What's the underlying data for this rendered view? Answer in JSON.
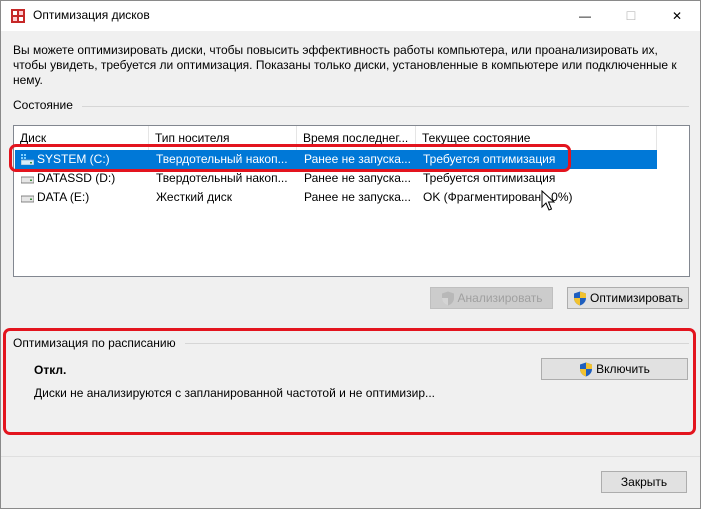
{
  "window": {
    "title": "Оптимизация дисков",
    "minimize_glyph": "—",
    "maximize_glyph": "☐",
    "close_glyph": "✕"
  },
  "description": "Вы можете оптимизировать диски, чтобы повысить эффективность работы  компьютера, или проанализировать их, чтобы увидеть, требуется ли оптимизация. Показаны только диски, установленные в компьютере или подключенные к нему.",
  "status_section": {
    "label": "Состояние",
    "columns": [
      "Диск",
      "Тип носителя",
      "Время последнег...",
      "Текущее состояние"
    ],
    "rows": [
      {
        "drive": "SYSTEM (C:)",
        "media": "Твердотельный накоп...",
        "last_run": "Ранее не запуска...",
        "status": "Требуется оптимизация",
        "selected": true,
        "icon": "system-drive-icon"
      },
      {
        "drive": "DATASSD (D:)",
        "media": "Твердотельный накоп...",
        "last_run": "Ранее не запуска...",
        "status": "Требуется оптимизация",
        "selected": false,
        "icon": "drive-icon"
      },
      {
        "drive": "DATA (E:)",
        "media": "Жесткий диск",
        "last_run": "Ранее не запуска...",
        "status": "OK (Фрагментировано 0%)",
        "selected": false,
        "icon": "drive-icon"
      }
    ]
  },
  "actions": {
    "analyze_label": "Анализировать",
    "analyze_enabled": false,
    "optimize_label": "Оптимизировать"
  },
  "schedule": {
    "label": "Оптимизация по расписанию",
    "status": "Откл.",
    "description": "Диски не анализируются с запланированной частотой и не оптимизир...",
    "enable_label": "Включить"
  },
  "footer": {
    "close_label": "Закрыть"
  },
  "colors": {
    "selection": "#0078d7",
    "highlight": "#e3141e",
    "background": "#f0f0f0"
  }
}
